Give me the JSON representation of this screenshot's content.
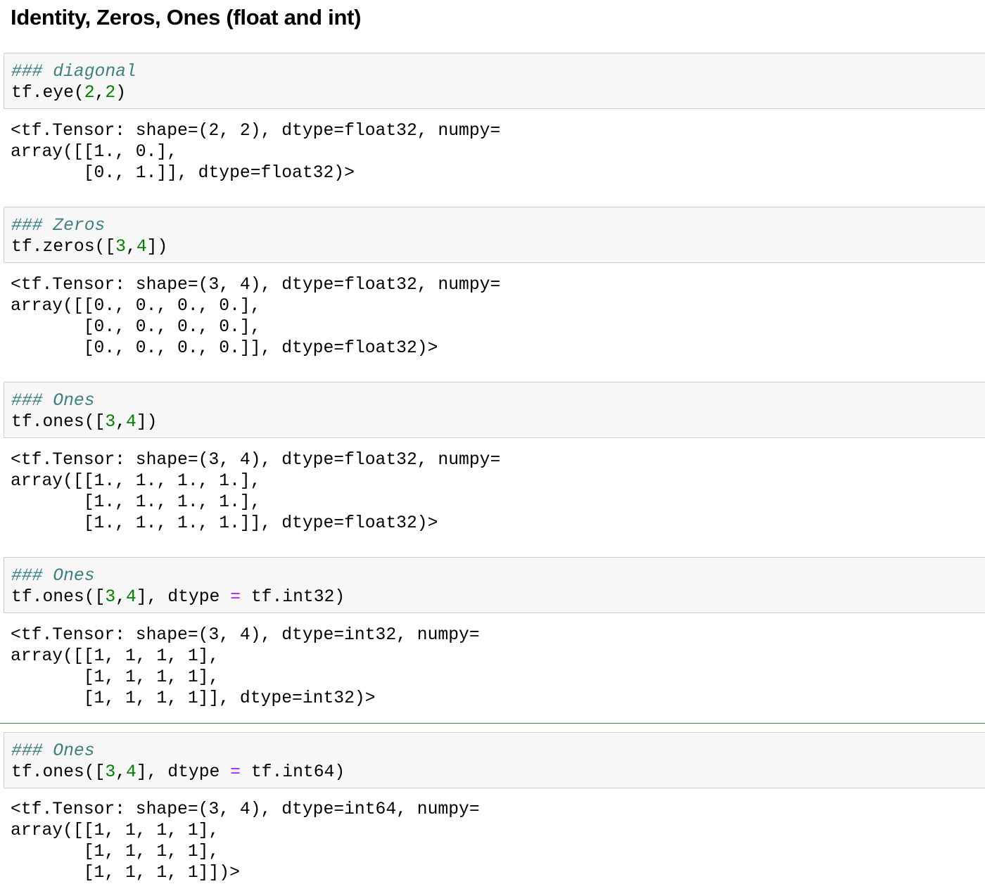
{
  "heading": "Identity, Zeros, Ones (float and int)",
  "cells": [
    {
      "comment": "### diagonal",
      "code": {
        "prefix": "tf.eye(",
        "n1": "2",
        "mid": ",",
        "n2": "2",
        "suffix": ")"
      },
      "output": [
        "<tf.Tensor: shape=(2, 2), dtype=float32, numpy=",
        "array([[1., 0.],",
        "       [0., 1.]], dtype=float32)>"
      ]
    },
    {
      "comment": "### Zeros",
      "code": {
        "prefix": "tf.zeros([",
        "n1": "3",
        "mid": ",",
        "n2": "4",
        "suffix": "])"
      },
      "output": [
        "<tf.Tensor: shape=(3, 4), dtype=float32, numpy=",
        "array([[0., 0., 0., 0.],",
        "       [0., 0., 0., 0.],",
        "       [0., 0., 0., 0.]], dtype=float32)>"
      ]
    },
    {
      "comment": "### Ones",
      "code": {
        "prefix": "tf.ones([",
        "n1": "3",
        "mid": ",",
        "n2": "4",
        "suffix": "])"
      },
      "output": [
        "<tf.Tensor: shape=(3, 4), dtype=float32, numpy=",
        "array([[1., 1., 1., 1.],",
        "       [1., 1., 1., 1.],",
        "       [1., 1., 1., 1.]], dtype=float32)>"
      ]
    },
    {
      "comment": "### Ones",
      "code": {
        "prefix": "tf.ones([",
        "n1": "3",
        "mid": ",",
        "n2": "4",
        "pre_eq": "], dtype ",
        "eq": "=",
        "post_eq": " tf.int32)"
      },
      "output": [
        "<tf.Tensor: shape=(3, 4), dtype=int32, numpy=",
        "array([[1, 1, 1, 1],",
        "       [1, 1, 1, 1],",
        "       [1, 1, 1, 1]], dtype=int32)>"
      ]
    },
    {
      "comment": "### Ones",
      "code": {
        "prefix": "tf.ones([",
        "n1": "3",
        "mid": ",",
        "n2": "4",
        "pre_eq": "], dtype ",
        "eq": "=",
        "post_eq": " tf.int64)"
      },
      "output": [
        "<tf.Tensor: shape=(3, 4), dtype=int64, numpy=",
        "array([[1, 1, 1, 1],",
        "       [1, 1, 1, 1],",
        "       [1, 1, 1, 1]])>"
      ]
    }
  ],
  "colors": {
    "comment": "#408080",
    "number": "#008000",
    "operator": "#aa22ff",
    "cell_background": "#f7f7f7",
    "cell_border": "#cfcfcf",
    "selected_separator": "#3b8a3b"
  }
}
